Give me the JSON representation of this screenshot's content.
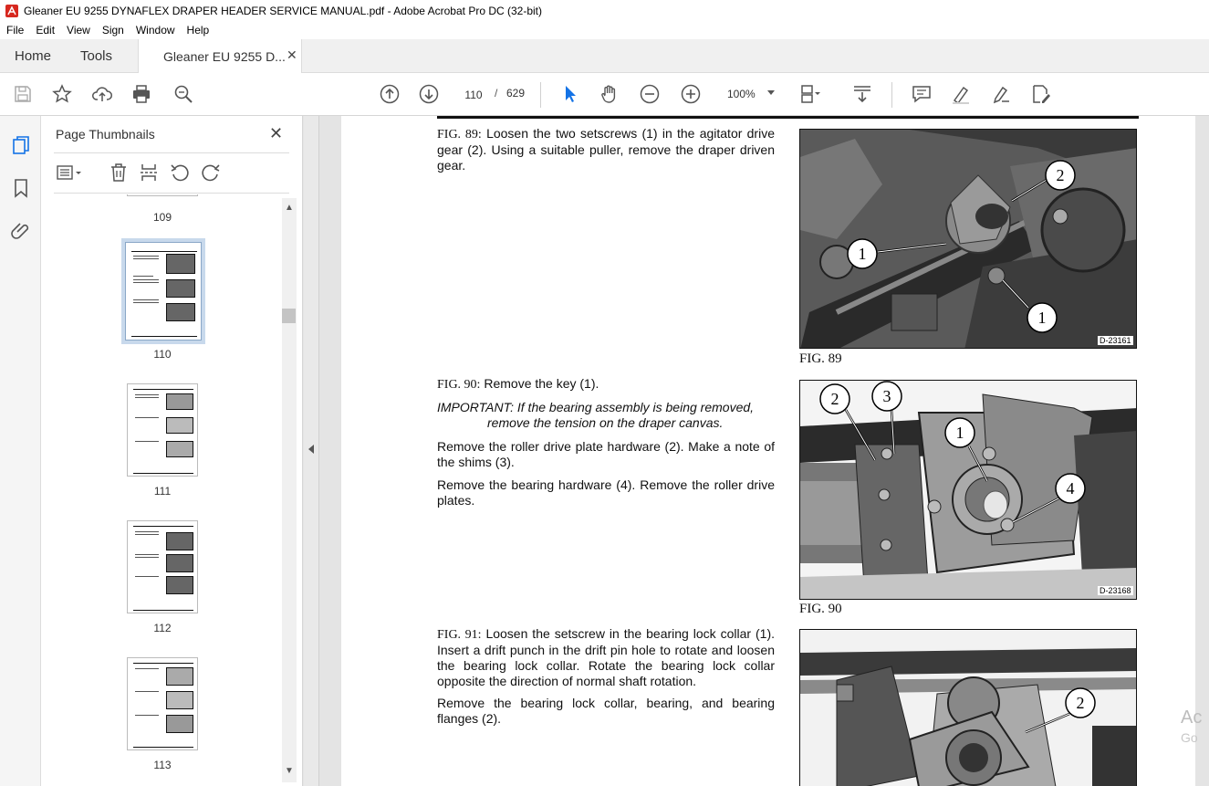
{
  "window": {
    "title": "Gleaner EU 9255 DYNAFLEX DRAPER HEADER SERVICE MANUAL.pdf - Adobe Acrobat Pro DC (32-bit)"
  },
  "menu": [
    "File",
    "Edit",
    "View",
    "Sign",
    "Window",
    "Help"
  ],
  "tabs": {
    "home": "Home",
    "tools": "Tools",
    "document": "Gleaner EU 9255 D..."
  },
  "toolbar": {
    "current_page": "110",
    "page_separator": "/",
    "total_pages": "629",
    "zoom": "100%"
  },
  "thumbnails_panel": {
    "title": "Page Thumbnails",
    "pages": [
      {
        "label": "109",
        "selected": false
      },
      {
        "label": "110",
        "selected": true
      },
      {
        "label": "111",
        "selected": false
      },
      {
        "label": "112",
        "selected": false
      },
      {
        "label": "113",
        "selected": false
      }
    ]
  },
  "document": {
    "fig89": {
      "prefix": "FIG. 89:",
      "text": " Loosen the two setscrews (1) in the agitator drive gear (2). Using a suitable puller, remove the draper driven gear.",
      "caption": "FIG. 89",
      "image_id": "D-23161",
      "callouts": [
        "1",
        "2",
        "1"
      ]
    },
    "fig90": {
      "prefix": "FIG. 90:",
      "text": " Remove the key (1).",
      "important_line1": "IMPORTANT:  If the bearing assembly is being removed,",
      "important_line2": "remove the tension on the draper canvas.",
      "para2": "Remove the roller drive plate hardware (2). Make a note of the shims (3).",
      "para3": "Remove the bearing hardware (4). Remove the roller drive plates.",
      "caption": "FIG. 90",
      "image_id": "D-23168",
      "callouts": [
        "1",
        "2",
        "3",
        "4"
      ]
    },
    "fig91": {
      "prefix": "FIG. 91:",
      "text": " Loosen the setscrew in the bearing lock collar (1). Insert a drift punch in the drift pin hole to rotate and loosen the bearing lock collar. Rotate the bearing lock collar opposite the direction of normal shaft rotation.",
      "para2": "Remove the bearing lock collar, bearing, and bearing flanges (2).",
      "callouts": [
        "2"
      ]
    }
  },
  "watermark": {
    "line1": "Ac",
    "line2": "Go"
  },
  "colors": {
    "accent_blue": "#1473e6",
    "acrobat_red": "#d7281f",
    "selection_outline": "#c8d9ec"
  }
}
